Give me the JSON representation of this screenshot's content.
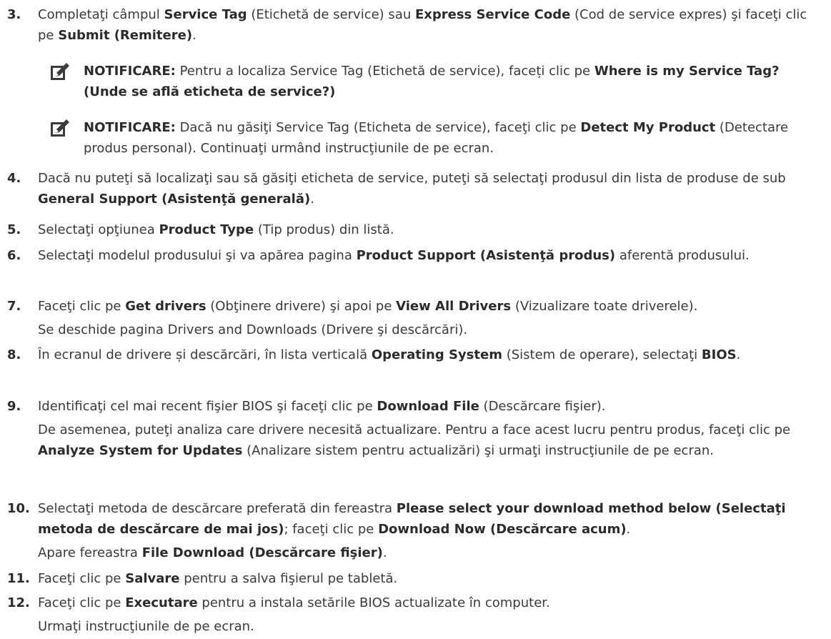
{
  "steps": [
    {
      "n": "3.",
      "parts": [
        [
          "",
          "Completaţi câmpul "
        ],
        [
          "b",
          "Service Tag"
        ],
        [
          "",
          " (Etichetă de service) sau "
        ],
        [
          "b",
          "Express Service Code"
        ],
        [
          "",
          " (Cod de service expres) şi faceţi clic pe "
        ],
        [
          "b",
          "Submit (Remitere)"
        ],
        [
          "",
          "."
        ]
      ]
    },
    {
      "n": "4.",
      "parts": [
        [
          "",
          "Dacă nu puteţi să localizaţi sau să găsiţi eticheta de service, puteţi să selectaţi produsul din lista de produse de sub "
        ],
        [
          "b",
          "General Support (Asistenţă generală)"
        ],
        [
          "",
          "."
        ]
      ]
    },
    {
      "n": "5.",
      "parts": [
        [
          "",
          "Selectaţi opţiunea "
        ],
        [
          "b",
          "Product Type"
        ],
        [
          "",
          " (Tip produs) din listă."
        ]
      ]
    },
    {
      "n": "6.",
      "parts": [
        [
          "",
          "Selectaţi modelul produsului şi va apărea pagina "
        ],
        [
          "b",
          "Product Support (Asistenţă produs)"
        ],
        [
          "",
          " aferentă produsului."
        ]
      ]
    },
    {
      "n": "7.",
      "parts": [
        [
          "",
          "Faceţi clic pe "
        ],
        [
          "b",
          "Get drivers"
        ],
        [
          "",
          " (Obţinere drivere) şi apoi pe "
        ],
        [
          "b",
          "View All Drivers"
        ],
        [
          "",
          " (Vizualizare toate driverele)."
        ]
      ],
      "sub": [
        [
          [
            "",
            "Se deschide pagina Drivers and Downloads (Drivere şi descărcări)."
          ]
        ]
      ]
    },
    {
      "n": "8.",
      "parts": [
        [
          "",
          "În ecranul de drivere și descărcări, în lista verticală "
        ],
        [
          "b",
          "Operating System"
        ],
        [
          "",
          " (Sistem de operare), selectaţi "
        ],
        [
          "b",
          "BIOS"
        ],
        [
          "",
          "."
        ]
      ]
    },
    {
      "n": "9.",
      "parts": [
        [
          "",
          "Identificaţi cel mai recent fişier BIOS şi faceţi clic pe "
        ],
        [
          "b",
          "Download File"
        ],
        [
          "",
          " (Descărcare fişier)."
        ]
      ],
      "sub": [
        [
          [
            "",
            "De asemenea, puteţi analiza care drivere necesită actualizare. Pentru a face acest lucru pentru produs, faceţi clic pe "
          ],
          [
            "b",
            "Analyze System for Updates"
          ],
          [
            "",
            " (Analizare sistem pentru actualizări) şi urmaţi instrucţiunile de pe ecran."
          ]
        ]
      ]
    },
    {
      "n": "10.",
      "parts": [
        [
          "",
          "Selectaţi metoda de descărcare preferată din fereastra "
        ],
        [
          "b",
          "Please select your download method below (Selectaţi metoda de descărcare de mai jos)"
        ],
        [
          "",
          "; faceţi clic pe "
        ],
        [
          "b",
          "Download Now (Descărcare acum)"
        ],
        [
          "",
          "."
        ]
      ],
      "sub": [
        [
          [
            "",
            "Apare fereastra "
          ],
          [
            "b",
            "File Download (Descărcare fişier)"
          ],
          [
            "",
            "."
          ]
        ]
      ]
    },
    {
      "n": "11.",
      "parts": [
        [
          "",
          "Faceţi clic pe "
        ],
        [
          "b",
          "Salvare"
        ],
        [
          "",
          " pentru a salva fişierul pe tabletă."
        ]
      ]
    },
    {
      "n": "12.",
      "parts": [
        [
          "",
          "Faceţi clic pe "
        ],
        [
          "b",
          "Executare"
        ],
        [
          "",
          " pentru a instala setările BIOS actualizate în computer."
        ]
      ],
      "sub": [
        [
          [
            "",
            "Urmaţi instrucţiunile de pe ecran."
          ]
        ]
      ]
    }
  ],
  "notes": [
    {
      "parts": [
        [
          "b",
          "NOTIFICARE:"
        ],
        [
          "",
          " Pentru a localiza Service Tag (Etichetă de service), faceți clic pe "
        ],
        [
          "b",
          "Where is my Service Tag? (Unde se află eticheta de service?)"
        ]
      ]
    },
    {
      "parts": [
        [
          "b",
          "NOTIFICARE:"
        ],
        [
          "",
          " Dacă nu găsiţi Service Tag (Eticheta de service), faceţi clic pe "
        ],
        [
          "b",
          "Detect My Product"
        ],
        [
          "",
          " (Detectare produs personal). Continuaţi urmând instrucţiunile de pe ecran."
        ]
      ]
    }
  ],
  "icons": {
    "note": "pencil-note-icon"
  }
}
